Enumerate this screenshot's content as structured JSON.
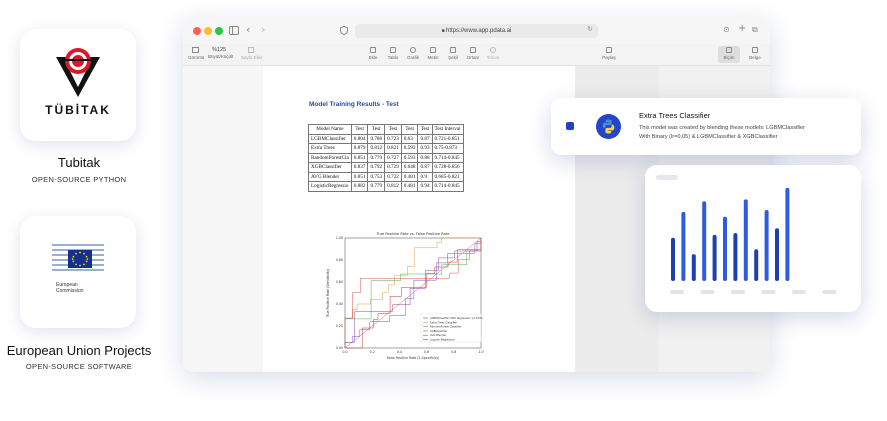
{
  "left_panel": {
    "tubitak": {
      "logo_text": "TÜBİTAK",
      "title": "Tubitak",
      "subtitle": "OPEN-SOURCE PYTHON"
    },
    "eu": {
      "logo_text_1": "European",
      "logo_text_2": "Commission",
      "title": "European Union Projects",
      "subtitle": "OPEN-SOURCE SOFTWARE"
    }
  },
  "browser": {
    "url": "https://www.app.pdata.ai",
    "toolbar": {
      "left": [
        {
          "label": "Görüntü",
          "name": "view"
        },
        {
          "label": "Büyüt/Küçült",
          "name": "zoom",
          "value": "%125"
        },
        {
          "label": "Sayfa Ekle",
          "name": "add-page"
        }
      ],
      "center": [
        {
          "label": "Ekle",
          "name": "insert"
        },
        {
          "label": "Tablo",
          "name": "table"
        },
        {
          "label": "Grafik",
          "name": "chart"
        },
        {
          "label": "Metin",
          "name": "text"
        },
        {
          "label": "Şekil",
          "name": "shape"
        },
        {
          "label": "Ortam",
          "name": "media"
        },
        {
          "label": "Yorum",
          "name": "comment"
        }
      ],
      "share": "Paylaş",
      "right": [
        {
          "label": "Biçim",
          "name": "format"
        },
        {
          "label": "Belge",
          "name": "document"
        }
      ]
    }
  },
  "document": {
    "title": "Model Training Results - Test",
    "table": {
      "headers": [
        "Model Name",
        "Test",
        "Test",
        "Test",
        "Test",
        "Test",
        "Test Interval"
      ],
      "rows": [
        [
          "LGBMClassifier",
          "0.804",
          "0.786",
          "0.723",
          "0.63",
          "0.87",
          "0.721-0.851"
        ],
        [
          "Extra Trees",
          "0.879",
          "0.812",
          "0.821",
          "0.593",
          "0.93",
          "0.75-0.873"
        ],
        [
          "RandomForestCla",
          "0.851",
          "0.779",
          "0.727",
          "0.593",
          "0.88",
          "0.714-0.845"
        ],
        [
          "XGBClassifier",
          "0.837",
          "0.792",
          "0.729",
          "0.648",
          "0.87",
          "0.728-0.856"
        ],
        [
          "AVG Blender",
          "0.851",
          "0.753",
          "0.722",
          "0.481",
          "0.9",
          "0.685-0.821"
        ],
        [
          "LogisticRegressio",
          "0.882",
          "0.779",
          "0.812",
          "0.481",
          "0.94",
          "0.714-0.845"
        ]
      ]
    },
    "roc_chart": {
      "title": "True Positive Rate vs. False Positive Rate",
      "xlabel": "False Positive Rate (1-Specificity)",
      "ylabel": "True Positive Rate (Sensitivity)",
      "x_ticks": [
        "0.0",
        "0.2",
        "0.4",
        "0.6",
        "0.8",
        "1.0"
      ],
      "y_ticks": [
        "0.00",
        "0.20",
        "0.40",
        "0.60",
        "0.80",
        "1.00"
      ],
      "legend": [
        "LGBMClassifier With Regression (l=0.05)",
        "Extra Trees Classifier",
        "RandomForest Classifier",
        "XGBClassifier",
        "AVG Blender",
        "Logistic Regression"
      ],
      "colors": [
        "#6a5acd",
        "#e89a3c",
        "#4caf50",
        "#d9534f",
        "#8e44ad",
        "#c0392b"
      ]
    }
  },
  "model_card": {
    "title": "Extra Trees Classifier",
    "description_line1": "This model was created by blending these models: LGBMClassifier",
    "description_line2": "With Binary (lr=0.05) & LGBMClassifier & XGBClassifier",
    "icon": "python-icon"
  },
  "bar_card": {
    "chart_data": {
      "type": "bar",
      "values": [
        0.45,
        0.72,
        0.28,
        0.83,
        0.48,
        0.67,
        0.5,
        0.85,
        0.33,
        0.74,
        0.55,
        0.97
      ]
    },
    "bar_colors": [
      "#1e3fae",
      "#2f5be0"
    ]
  }
}
